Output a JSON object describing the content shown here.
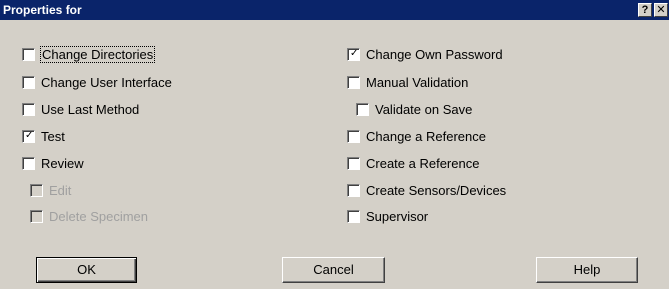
{
  "window": {
    "title": "Properties for",
    "help_glyph": "?",
    "close_glyph": "✕"
  },
  "left_options": [
    {
      "label": "Change Directories",
      "checked": false,
      "enabled": true
    },
    {
      "label": "Change User Interface",
      "checked": false,
      "enabled": true
    },
    {
      "label": "Use Last Method",
      "checked": false,
      "enabled": true
    },
    {
      "label": "Test",
      "checked": true,
      "enabled": true
    },
    {
      "label": "Review",
      "checked": false,
      "enabled": true
    },
    {
      "label": "Edit",
      "checked": false,
      "enabled": false
    },
    {
      "label": "Delete Specimen",
      "checked": false,
      "enabled": false
    }
  ],
  "right_options": [
    {
      "label": "Change Own Password",
      "checked": true,
      "enabled": true
    },
    {
      "label": "Manual Validation",
      "checked": false,
      "enabled": true
    },
    {
      "label": "Validate on Save",
      "checked": false,
      "enabled": true
    },
    {
      "label": "Change a Reference",
      "checked": false,
      "enabled": true
    },
    {
      "label": "Create a Reference",
      "checked": false,
      "enabled": true
    },
    {
      "label": "Create Sensors/Devices",
      "checked": false,
      "enabled": true
    },
    {
      "label": "Supervisor",
      "checked": false,
      "enabled": true
    }
  ],
  "buttons": {
    "ok": "OK",
    "cancel": "Cancel",
    "help": "Help"
  },
  "check_glyph": "✓"
}
